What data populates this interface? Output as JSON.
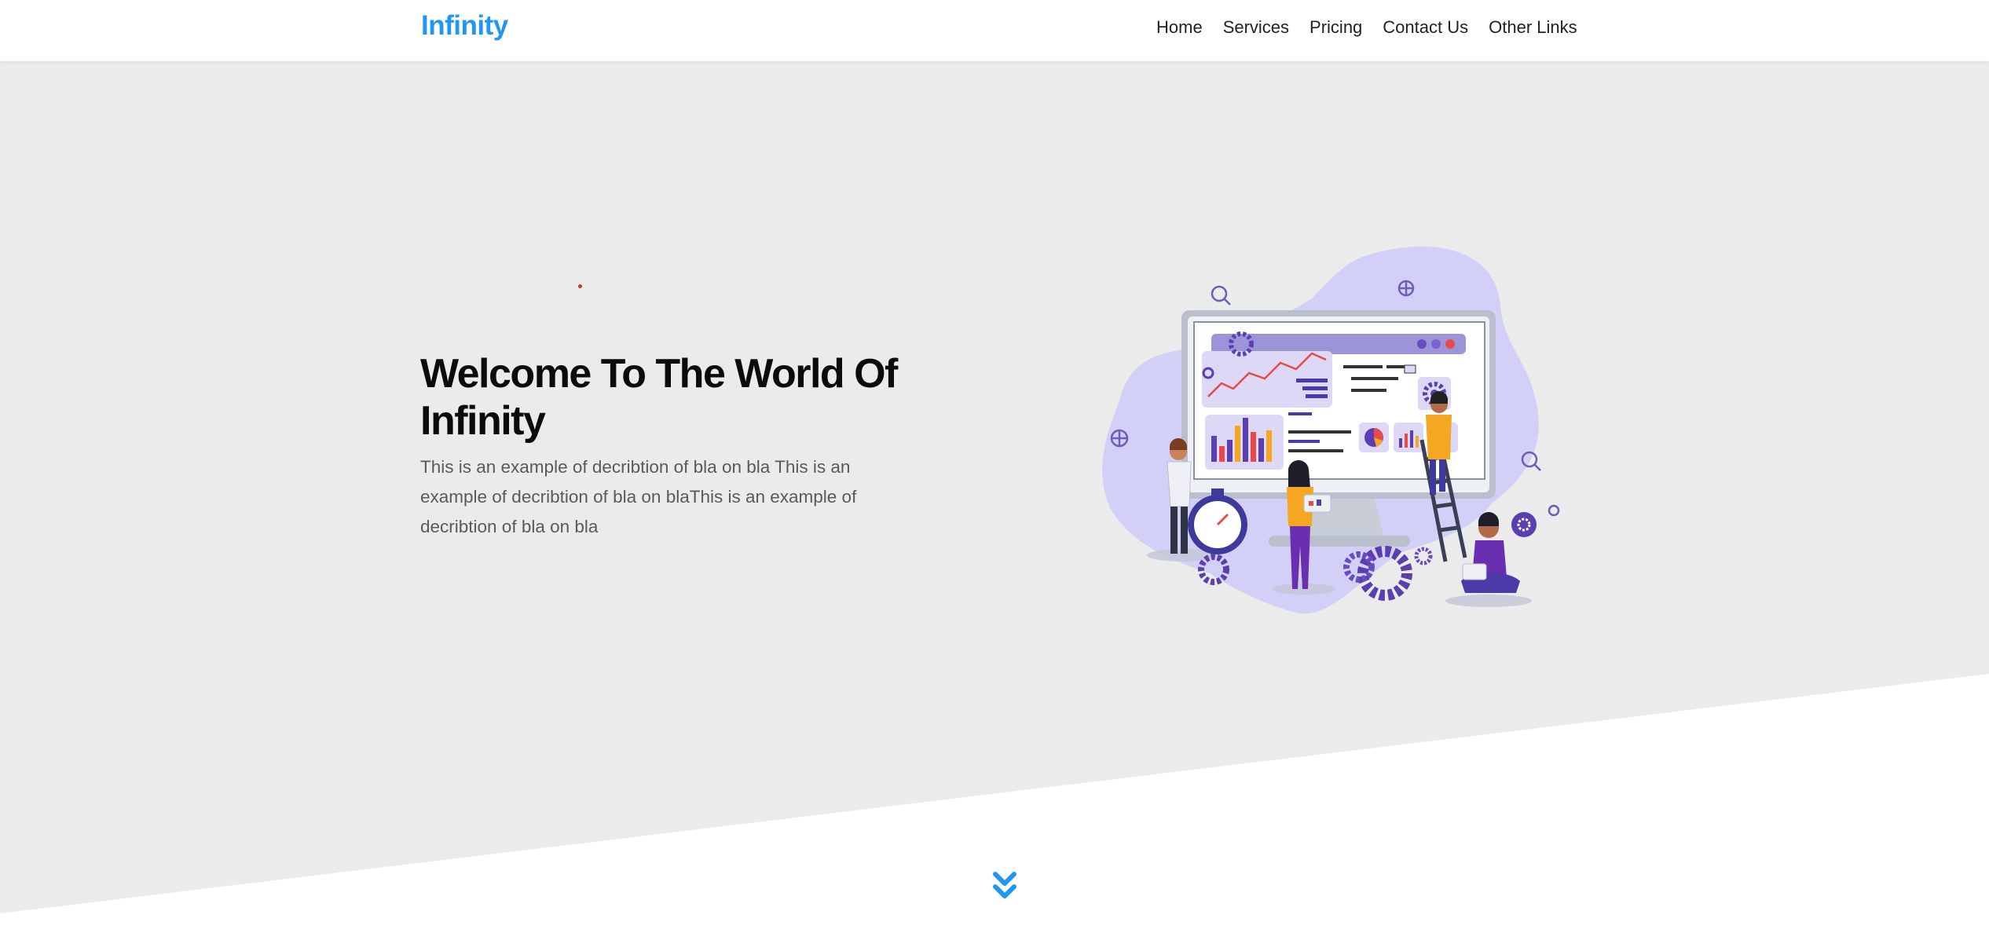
{
  "nav": {
    "brand": "Infinity",
    "links": [
      "Home",
      "Services",
      "Pricing",
      "Contact Us",
      "Other Links"
    ]
  },
  "hero": {
    "title": "Welcome To The World Of Infinity",
    "description": "This is an example of decribtion of bla on bla This is an example of decribtion of bla on blaThis is an example of decribtion of bla on bla"
  },
  "colors": {
    "brand": "#2196f3",
    "hero_background": "#ebebeb",
    "page_background": "#ffffff",
    "illustration_primary": "#5b3fb0",
    "illustration_accent": "#f5a623"
  },
  "icons": {
    "scroll": "double-chevron-down-icon"
  }
}
